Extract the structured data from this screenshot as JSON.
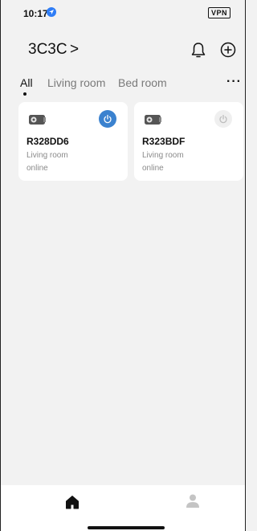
{
  "status_bar": {
    "time": "10:17",
    "vpn": "VPN"
  },
  "header": {
    "home_name": "3C3C",
    "chevron": ">",
    "bell_icon": "bell-icon",
    "add_icon": "plus-circle-icon"
  },
  "tabs": {
    "items": [
      {
        "label": "All",
        "active": true
      },
      {
        "label": "Living room",
        "active": false
      },
      {
        "label": "Bed room",
        "active": false
      }
    ],
    "more": "···"
  },
  "devices": [
    {
      "name": "R328DD6",
      "room": "Living room",
      "status": "online",
      "power": "on",
      "icon": "device-icon"
    },
    {
      "name": "R323BDF",
      "room": "Living room",
      "status": "online",
      "power": "off",
      "icon": "device-icon"
    }
  ],
  "bottom_nav": {
    "home_icon": "home-icon",
    "profile_icon": "person-icon"
  },
  "colors": {
    "accent": "#3b82cf",
    "background": "#f2f2f2"
  }
}
